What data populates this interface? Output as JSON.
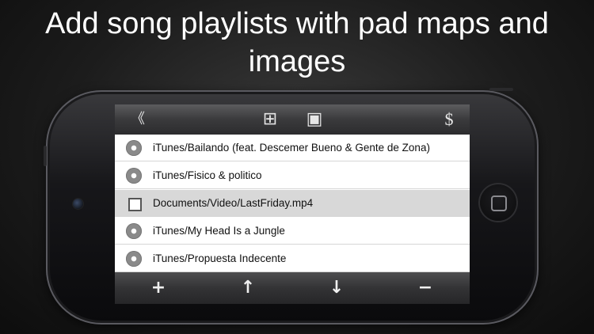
{
  "headline": "Add song playlists with pad maps and images",
  "toolbar": {
    "back_icon": "chevron-left-icon",
    "back_glyph": "《",
    "grid_icon": "grid-icon",
    "grid_glyph": "⊞",
    "frame_icon": "square-frame-icon",
    "frame_glyph": "▣",
    "purchase_icon": "dollar-icon",
    "purchase_glyph": "$"
  },
  "playlist": {
    "items": [
      {
        "label": "iTunes/Bailando (feat. Descemer Bueno & Gente de Zona)",
        "icon": "disc-icon",
        "selected": false
      },
      {
        "label": "iTunes/Fisico & politico",
        "icon": "disc-icon",
        "selected": false
      },
      {
        "label": "Documents/Video/LastFriday.mp4",
        "icon": "video-file-icon",
        "selected": true
      },
      {
        "label": "iTunes/My Head Is a Jungle",
        "icon": "disc-icon",
        "selected": false
      },
      {
        "label": "iTunes/Propuesta Indecente",
        "icon": "disc-icon",
        "selected": false
      }
    ]
  },
  "bottombar": {
    "add_glyph": "+",
    "up_glyph": "↑",
    "down_glyph": "↓",
    "remove_glyph": "−"
  },
  "colors": {
    "selected_row": "#d8d8d8",
    "toolbar": "#3a3a3c",
    "background": "#1c1c1c"
  }
}
